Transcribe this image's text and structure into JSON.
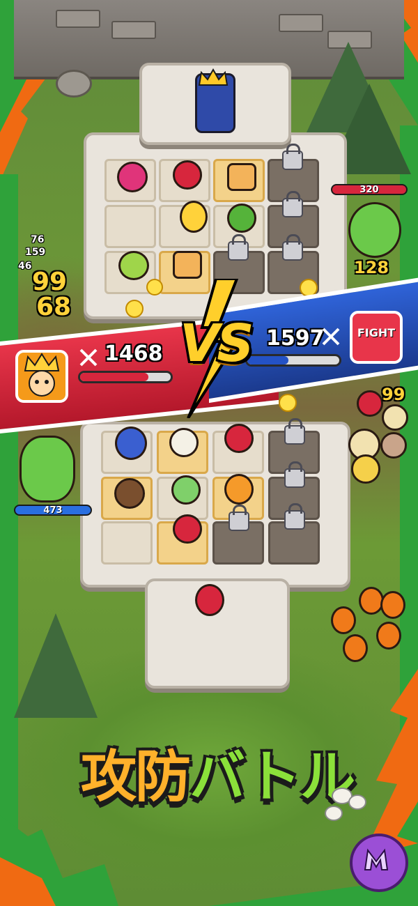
{
  "battle": {
    "player_power": "1468",
    "enemy_power": "1597",
    "vs_label": "VS",
    "enemy_badge_label": "FIGHT",
    "player_health_fraction": 0.75,
    "enemy_health_fraction": 0.45
  },
  "damage_numbers": {
    "left_list": [
      "76",
      "159",
      "46",
      "99",
      "68"
    ],
    "enemy_hp_label": "320",
    "enemy_dmg": "128",
    "right_dmg": "99",
    "ally_hp_label": "473"
  },
  "title_text": "攻防バトル",
  "colors": {
    "red_team": "#d7263d",
    "blue_team": "#2452c5",
    "title_orange": "#ffb12b",
    "title_green": "#8be03a",
    "frame_green": "#2fa23a",
    "frame_orange": "#f06a12"
  },
  "icons": [
    "sword-icon",
    "lock-icon",
    "crown-icon",
    "app-logo-icon"
  ]
}
